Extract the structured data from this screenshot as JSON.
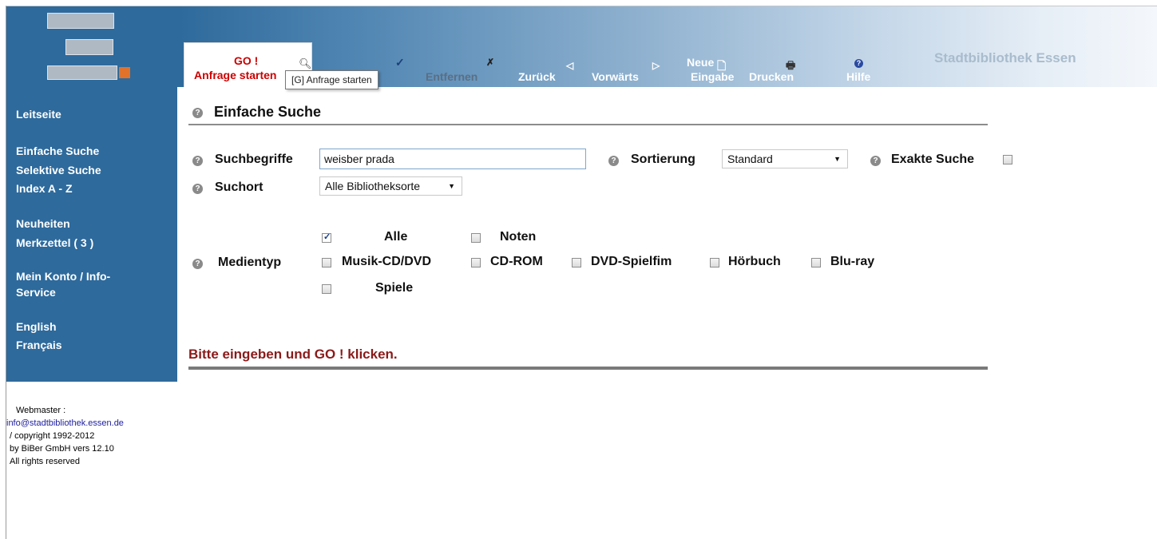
{
  "brand": "Stadtbibliothek Essen",
  "toolbar": {
    "go_label": "GO !",
    "go_sub": "Anfrage starten",
    "tooltip": "[G] Anfrage starten",
    "entfernen": "Entfernen",
    "zurueck": "Zurück",
    "vorwaerts": "Vorwärts",
    "neue_line1": "Neue",
    "neue_line2": "Eingabe",
    "drucken": "Drucken",
    "hilfe": "Hilfe"
  },
  "sidebar": {
    "items": [
      "Leitseite",
      "Einfache Suche",
      "Selektive Suche",
      "Index A - Z",
      "Neuheiten",
      "Merkzettel ( 3 )",
      "Mein Konto / Info-",
      "Service",
      "English",
      "Français"
    ]
  },
  "footer": {
    "line1": "Webmaster :",
    "email": "info@stadtbibliothek.essen.de",
    "line3": "/ copyright 1992-2012",
    "line4": "by BiBer GmbH vers 12.10",
    "line5": "All rights reserved"
  },
  "main": {
    "title": "Einfache Suche",
    "suchbegriffe_label": "Suchbegriffe",
    "suchbegriffe_value": "weisber prada",
    "sortierung_label": "Sortierung",
    "sortierung_value": "Standard",
    "exakte_label": "Exakte Suche",
    "suchort_label": "Suchort",
    "suchort_value": "Alle Bibliotheksorte",
    "medientyp_label": "Medientyp",
    "media": {
      "alle": "Alle",
      "noten": "Noten",
      "musik": "Musik-CD/DVD",
      "cdrom": "CD-ROM",
      "dvd": "DVD-Spielfim",
      "hoerbuch": "Hörbuch",
      "bluray": "Blu-ray",
      "spiele": "Spiele"
    },
    "alle_checked": true,
    "message": "Bitte eingeben und GO ! klicken."
  }
}
